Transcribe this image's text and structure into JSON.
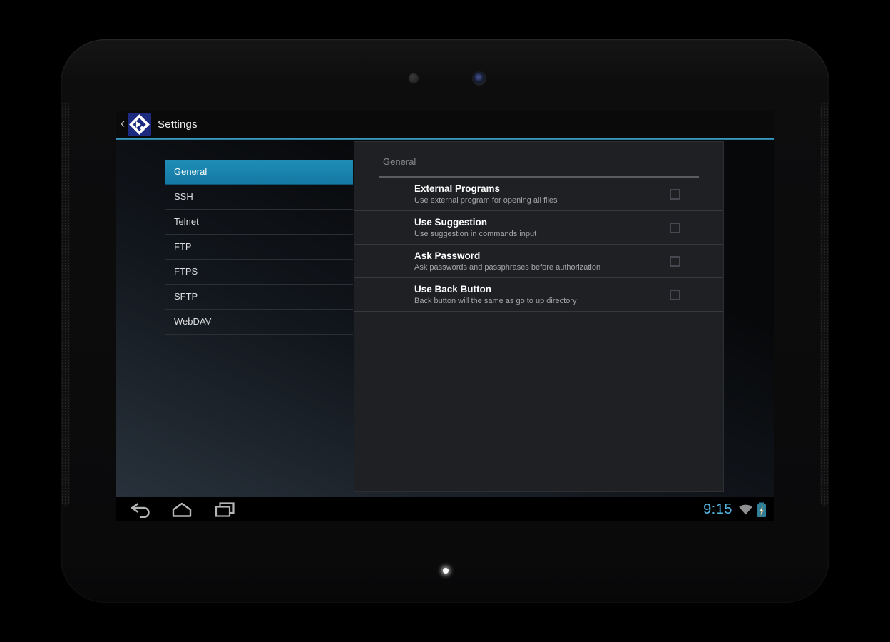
{
  "action_bar": {
    "back_glyph": "‹",
    "app_icon": "app-logo-diamond-icon",
    "title": "Settings"
  },
  "sidebar": {
    "items": [
      {
        "label": "General",
        "selected": true
      },
      {
        "label": "SSH",
        "selected": false
      },
      {
        "label": "Telnet",
        "selected": false
      },
      {
        "label": "FTP",
        "selected": false
      },
      {
        "label": "FTPS",
        "selected": false
      },
      {
        "label": "SFTP",
        "selected": false
      },
      {
        "label": "WebDAV",
        "selected": false
      }
    ]
  },
  "panel": {
    "header": "General",
    "items": [
      {
        "title": "External Programs",
        "subtitle": "Use external program for opening all files",
        "checked": false
      },
      {
        "title": "Use Suggestion",
        "subtitle": "Use suggestion in commands input",
        "checked": false
      },
      {
        "title": "Ask Password",
        "subtitle": "Ask passwords and passphrases before authorization",
        "checked": false
      },
      {
        "title": "Use Back Button",
        "subtitle": "Back button will the same as go to up directory",
        "checked": false
      }
    ]
  },
  "nav_bar": {
    "time": "9:15",
    "icons": [
      "back-icon",
      "home-icon",
      "recents-icon",
      "wifi-icon",
      "battery-charging-icon"
    ]
  },
  "colors": {
    "accent_line": "#3f9fc8",
    "selected_item": "#1980ab",
    "time_text": "#53b7e2",
    "battery": "#2f7f99",
    "card_bg": "#1f2024"
  }
}
